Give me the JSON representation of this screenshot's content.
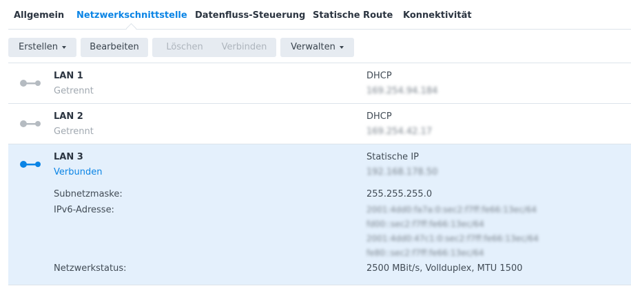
{
  "tabs": [
    "Allgemein",
    "Netzwerkschnittstelle",
    "Datenfluss-Steuerung",
    "Statische Route",
    "Konnektivität"
  ],
  "active_tab": "Netzwerkschnittstelle",
  "toolbar": {
    "create": "Erstellen",
    "edit": "Bearbeiten",
    "delete": "Löschen",
    "connect": "Verbinden",
    "manage": "Verwalten"
  },
  "interfaces": [
    {
      "name": "LAN 1",
      "status": "Getrennt",
      "mode": "DHCP",
      "ip": "169.254.94.184"
    },
    {
      "name": "LAN 2",
      "status": "Getrennt",
      "mode": "DHCP",
      "ip": "169.254.42.17"
    },
    {
      "name": "LAN 3",
      "status": "Verbunden",
      "mode": "Statische IP",
      "ip": "192.168.178.50"
    }
  ],
  "details": {
    "subnet_label": "Subnetzmaske:",
    "subnet": "255.255.255.0",
    "ipv6_label": "IPv6-Adresse:",
    "ipv6": [
      "2001:4dd0:fa7a:0:sec2:f7ff:fe66:13ec/64",
      "fd00::sec2:f7ff:fe66:13ec/64",
      "2001:4dd0:47c1:0:sec2:f7ff:fe66:13ec/64",
      "fe80::sec2:f7ff:fe66:13ec/64"
    ],
    "netstatus_label": "Netzwerkstatus:",
    "netstatus": "2500 MBit/s, Vollduplex, MTU 1500"
  },
  "colors": {
    "accent": "#0a84e5",
    "disconnected": "#b5bbc1",
    "selected_bg": "#e4f0fc"
  }
}
